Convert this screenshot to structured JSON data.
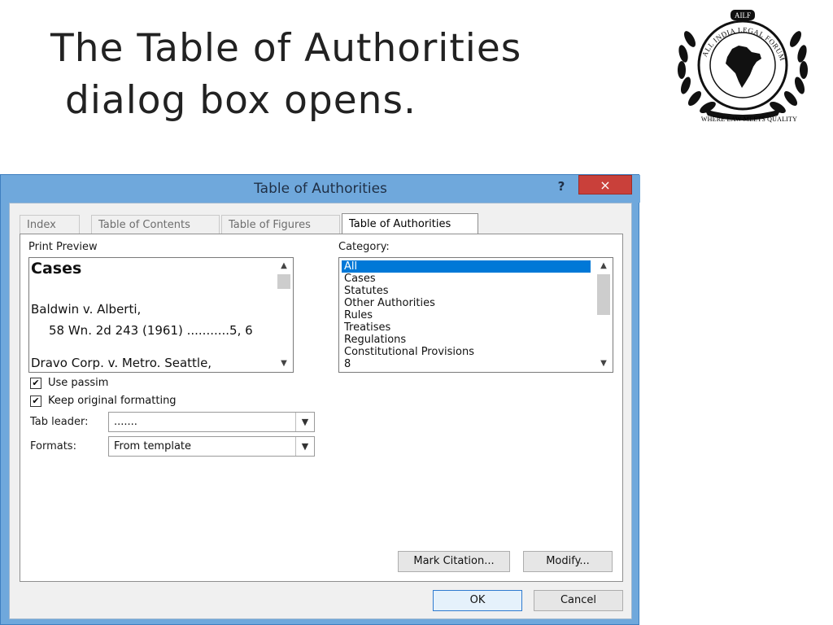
{
  "slide": {
    "title_line1": "The Table of Authorities",
    "title_line2": "dialog box opens."
  },
  "logo": {
    "badge_text": "AILF",
    "ring_text": "ALL INDIA LEGAL FORUM",
    "tagline": "WHERE LAW MEETS QUALITY"
  },
  "dialog": {
    "title": "Table of Authorities",
    "help_label": "?",
    "close_label": "×",
    "tabs": [
      {
        "label": "Index"
      },
      {
        "label": "Table of Contents"
      },
      {
        "label": "Table of Figures"
      },
      {
        "label": "Table of Authorities",
        "active": true
      }
    ],
    "print_preview": {
      "label": "Print Preview",
      "heading": "Cases",
      "lines": [
        "Baldwin v. Alberti,",
        "58 Wn. 2d 243 (1961) ...........5, 6",
        "Dravo Corp. v. Metro. Seattle,"
      ]
    },
    "category": {
      "label": "Category:",
      "items": [
        "All",
        "Cases",
        "Statutes",
        "Other Authorities",
        "Rules",
        "Treatises",
        "Regulations",
        "Constitutional Provisions",
        "8"
      ],
      "selected": "All"
    },
    "options": {
      "use_passim": {
        "label": "Use passim",
        "checked": true
      },
      "keep_formatting": {
        "label": "Keep original formatting",
        "checked": true
      }
    },
    "tab_leader": {
      "label": "Tab leader:",
      "value": "......."
    },
    "formats": {
      "label": "Formats:",
      "value": "From template"
    },
    "buttons": {
      "mark_citation": "Mark Citation...",
      "modify": "Modify...",
      "ok": "OK",
      "cancel": "Cancel"
    }
  },
  "colors": {
    "window_frame": "#6fa8dc",
    "close_button": "#c9403a",
    "selection": "#0078d7"
  }
}
